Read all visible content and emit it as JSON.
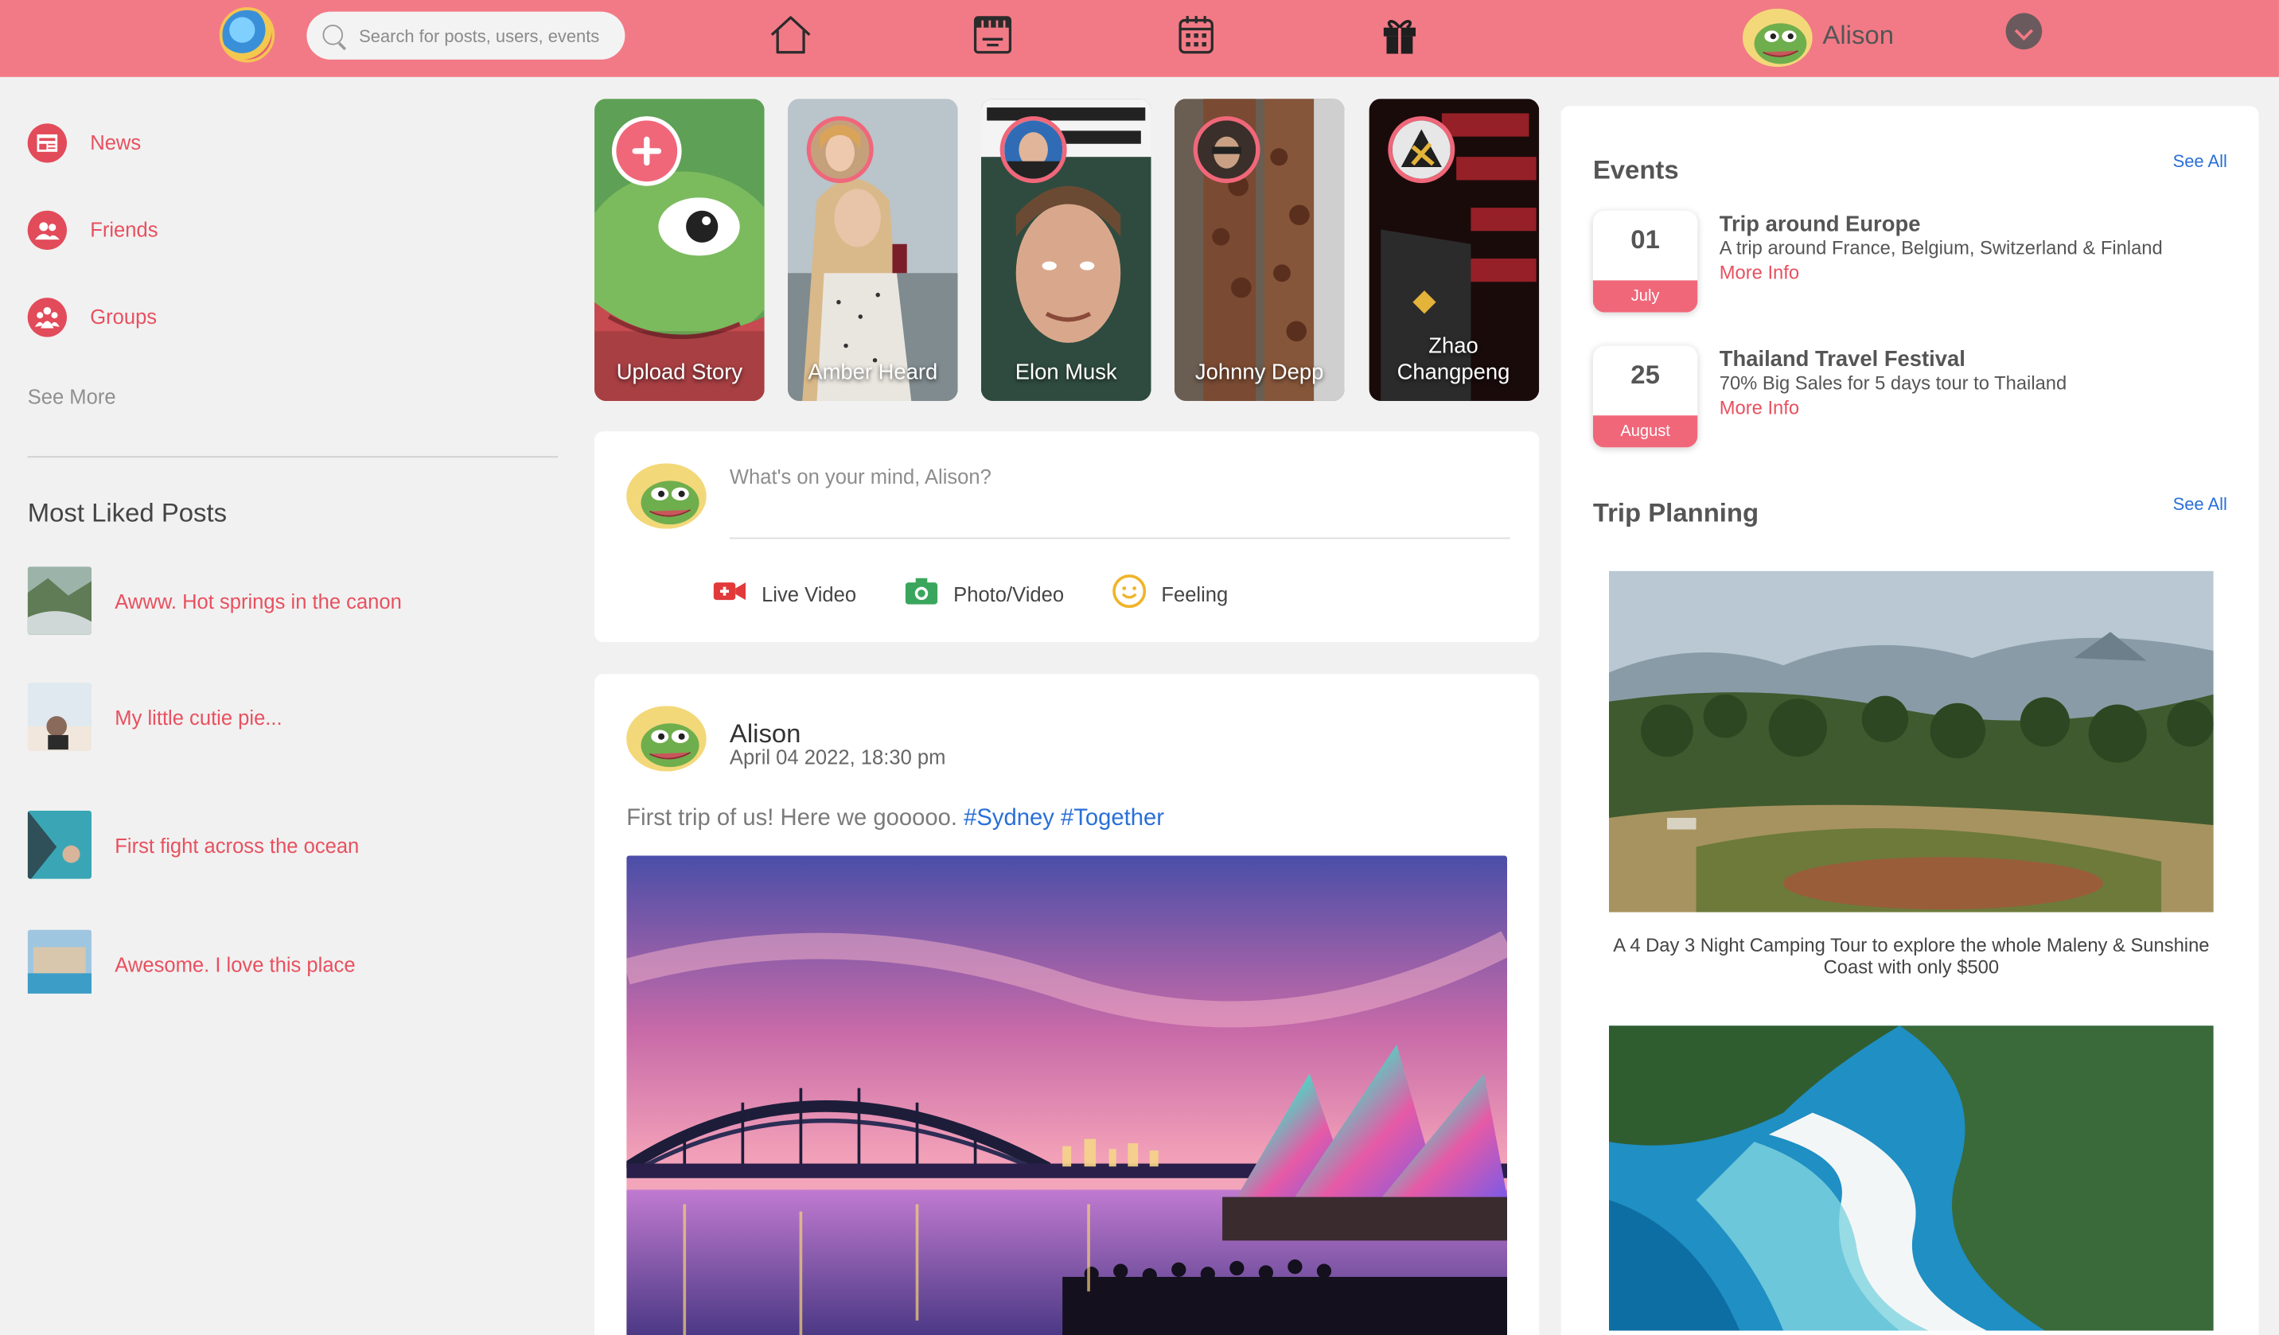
{
  "header": {
    "search_placeholder": "Search for posts, users, events",
    "user_name": "Alison",
    "nav_icons": [
      "home-icon",
      "watch-icon",
      "calendar-icon",
      "gift-icon"
    ]
  },
  "sidebar": {
    "items": [
      {
        "label": "News",
        "icon": "news-icon"
      },
      {
        "label": "Friends",
        "icon": "friends-icon"
      },
      {
        "label": "Groups",
        "icon": "groups-icon"
      }
    ],
    "see_more": "See More"
  },
  "most_liked": {
    "title": "Most Liked Posts",
    "posts": [
      {
        "title": "Awww. Hot springs in the canon"
      },
      {
        "title": "My little cutie pie..."
      },
      {
        "title": "First fight across the ocean"
      },
      {
        "title": "Awesome. I love this place"
      }
    ]
  },
  "stories": [
    {
      "name": "Upload Story"
    },
    {
      "name": "Amber Heard"
    },
    {
      "name": "Elon Musk"
    },
    {
      "name": "Johnny Depp"
    },
    {
      "name": "Zhao Changpeng"
    }
  ],
  "composer": {
    "placeholder": "What's on your mind, Alison?",
    "actions": [
      {
        "label": "Live Video",
        "icon": "live-video-icon"
      },
      {
        "label": "Photo/Video",
        "icon": "camera-icon"
      },
      {
        "label": "Feeling",
        "icon": "smiley-icon"
      }
    ]
  },
  "post": {
    "author": "Alison",
    "timestamp": "April 04 2022, 18:30 pm",
    "text": "First trip of us! Here we gooooo.",
    "hashtags": [
      "#Sydney",
      "#Together"
    ]
  },
  "events": {
    "title": "Events",
    "see_all": "See All",
    "items": [
      {
        "day": "01",
        "month": "July",
        "title": "Trip around Europe",
        "description": "A trip around France, Belgium, Switzerland & Finland",
        "more": "More Info"
      },
      {
        "day": "25",
        "month": "August",
        "title": "Thailand Travel Festival",
        "description": "70% Big Sales for 5 days tour to Thailand",
        "more": "More Info"
      }
    ]
  },
  "trip_planning": {
    "title": "Trip Planning",
    "see_all": "See All",
    "items": [
      {
        "caption": "A 4 Day 3 Night Camping Tour to explore the whole Maleny & Sunshine Coast with only $500"
      }
    ]
  },
  "colors": {
    "topbar": "#f27a86",
    "accent": "#e8505f",
    "link": "#2a6fd8",
    "background": "#f1f1f1"
  }
}
